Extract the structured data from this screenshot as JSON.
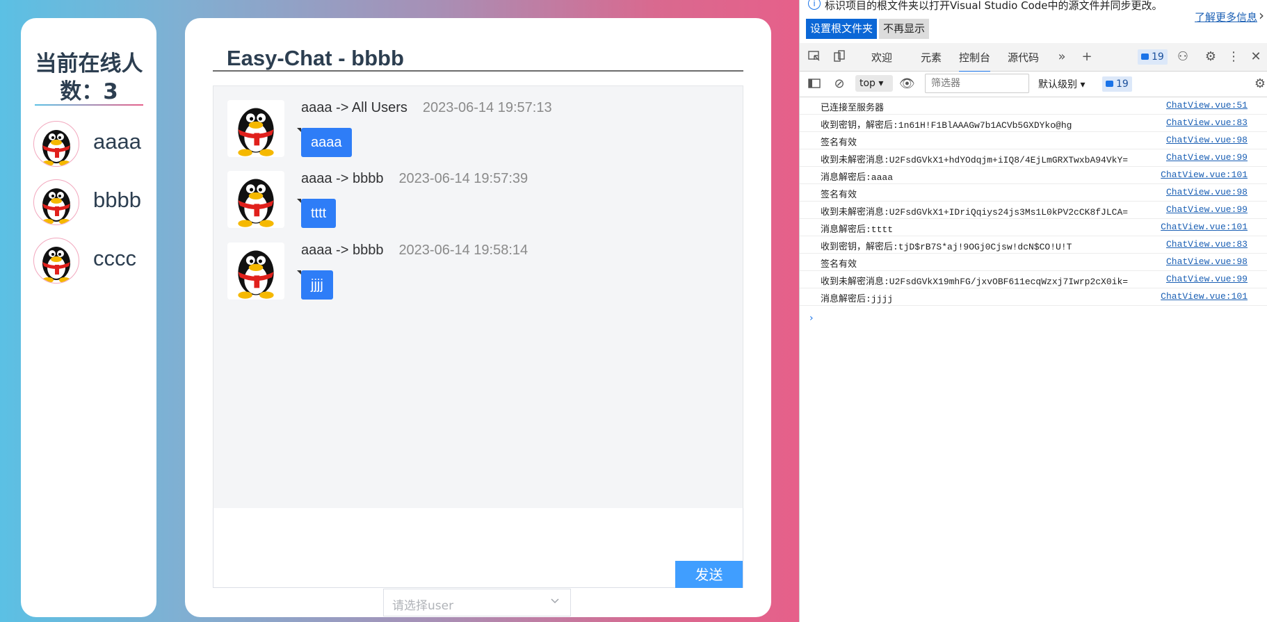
{
  "online": {
    "title": "当前在线人数：3",
    "users": [
      {
        "name": "aaaa"
      },
      {
        "name": "bbbb"
      },
      {
        "name": "cccc"
      }
    ]
  },
  "chat": {
    "title": "Easy-Chat - bbbb",
    "messages": [
      {
        "header": "aaaa -> All Users",
        "time": "2023-06-14 19:57:13",
        "text": "aaaa"
      },
      {
        "header": "aaaa -> bbbb",
        "time": "2023-06-14 19:57:39",
        "text": "tttt"
      },
      {
        "header": "aaaa -> bbbb",
        "time": "2023-06-14 19:58:14",
        "text": "jjjj"
      }
    ],
    "send_label": "发送",
    "select_placeholder": "请选择user"
  },
  "devtools": {
    "info_text": "标识项目的根文件夹以打开Visual Studio Code中的源文件并同步更改。",
    "learn_more": "了解更多信息",
    "set_root_button": "设置根文件夹",
    "dismiss_button": "不再显示",
    "tabs": [
      "欢迎",
      "元素",
      "控制台",
      "源代码"
    ],
    "active_tab": "控制台",
    "issues_count": "19",
    "context": "top",
    "filter_placeholder": "筛选器",
    "level": "默认级别",
    "console_count": "19",
    "logs": [
      {
        "text": "已连接至服务器",
        "src": "ChatView.vue:51"
      },
      {
        "text": "收到密钥，解密后:1n61H!F1BlAAAGw7b1ACVb5GXDYko@hg",
        "src": "ChatView.vue:83"
      },
      {
        "text": "签名有效",
        "src": "ChatView.vue:98"
      },
      {
        "text": "收到未解密消息:U2FsdGVkX1+hdYOdqjm+iIQ8/4EjLmGRXTwxbA94VkY=",
        "src": "ChatView.vue:99"
      },
      {
        "text": "消息解密后:aaaa",
        "src": "ChatView.vue:101"
      },
      {
        "text": "签名有效",
        "src": "ChatView.vue:98"
      },
      {
        "text": "收到未解密消息:U2FsdGVkX1+IDriQqiys24js3Ms1L0kPV2cCK8fJLCA=",
        "src": "ChatView.vue:99"
      },
      {
        "text": "消息解密后:tttt",
        "src": "ChatView.vue:101"
      },
      {
        "text": "收到密钥，解密后:tjD$rB7S*aj!9OGj0Cjsw!dcN$CO!U!T",
        "src": "ChatView.vue:83"
      },
      {
        "text": "签名有效",
        "src": "ChatView.vue:98"
      },
      {
        "text": "收到未解密消息:U2FsdGVkX19mhFG/jxvOBF611ecqWzxj7Iwrp2cX0ik=",
        "src": "ChatView.vue:99"
      },
      {
        "text": "消息解密后:jjjj",
        "src": "ChatView.vue:101"
      }
    ],
    "prompt": "›"
  }
}
